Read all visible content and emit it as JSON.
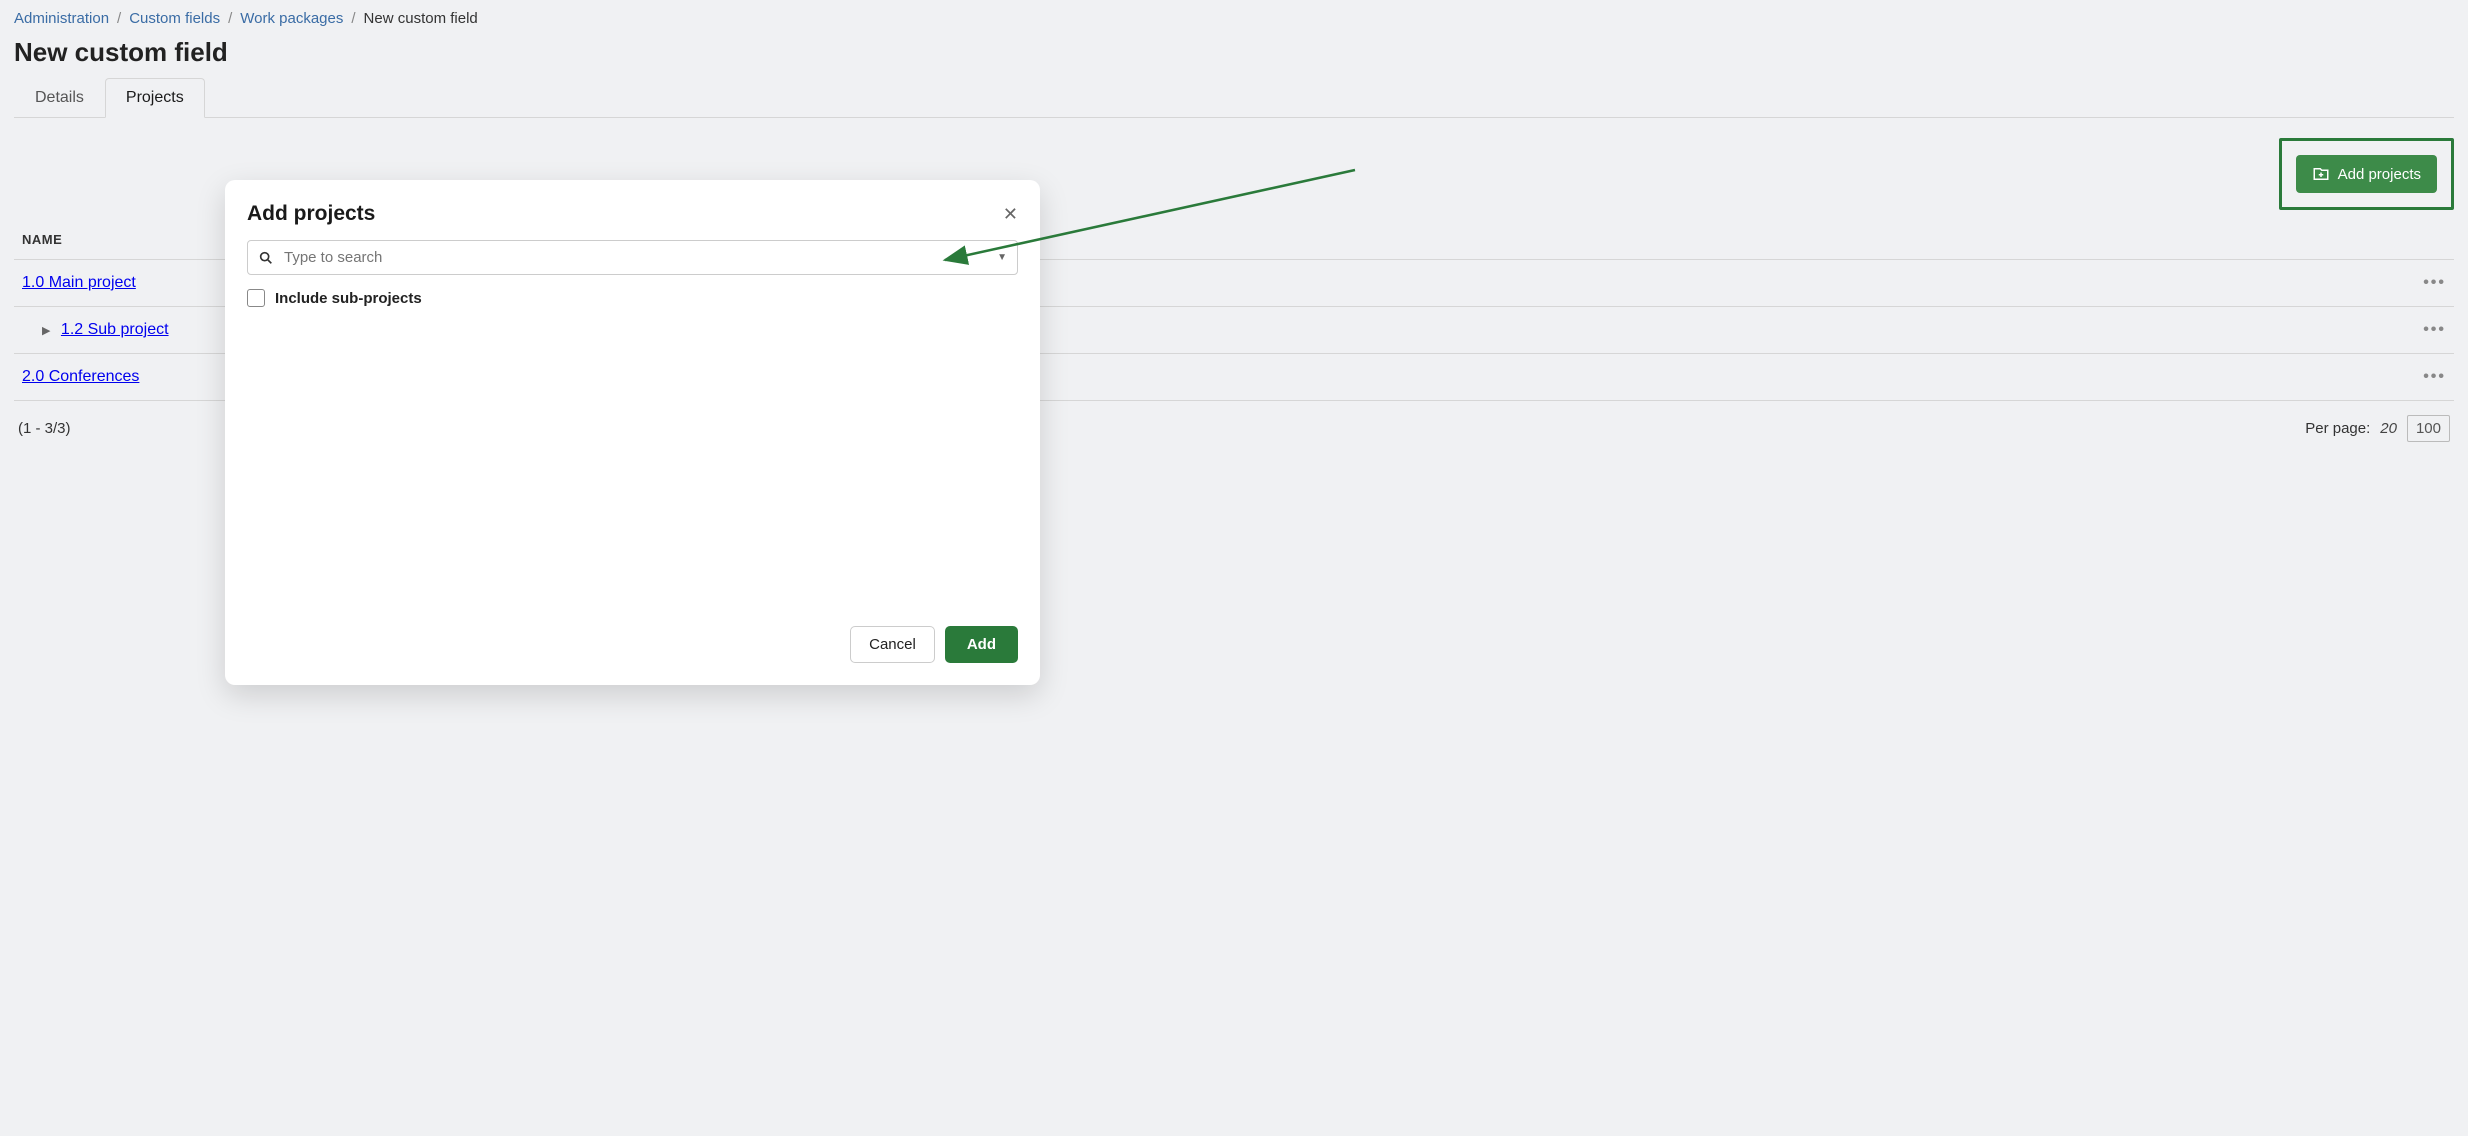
{
  "breadcrumb": {
    "items": [
      "Administration",
      "Custom fields",
      "Work packages"
    ],
    "current": "New custom field"
  },
  "page_title": "New custom field",
  "tabs": {
    "items": [
      {
        "label": "Details",
        "active": false
      },
      {
        "label": "Projects",
        "active": true
      }
    ]
  },
  "toolbar": {
    "add_projects_label": "Add projects"
  },
  "table": {
    "header_name": "NAME",
    "rows": [
      {
        "label": "1.0 Main project",
        "indent": false,
        "expandable": false
      },
      {
        "label": "1.2 Sub project",
        "indent": true,
        "expandable": true
      },
      {
        "label": "2.0 Conferences",
        "indent": false,
        "expandable": false
      }
    ]
  },
  "pager": {
    "range": "(1 - 3/3)",
    "per_page_label": "Per page:",
    "option_current": "20",
    "option_other": "100"
  },
  "modal": {
    "title": "Add projects",
    "search_placeholder": "Type to search",
    "include_sub_label": "Include sub-projects",
    "cancel_label": "Cancel",
    "add_label": "Add"
  }
}
